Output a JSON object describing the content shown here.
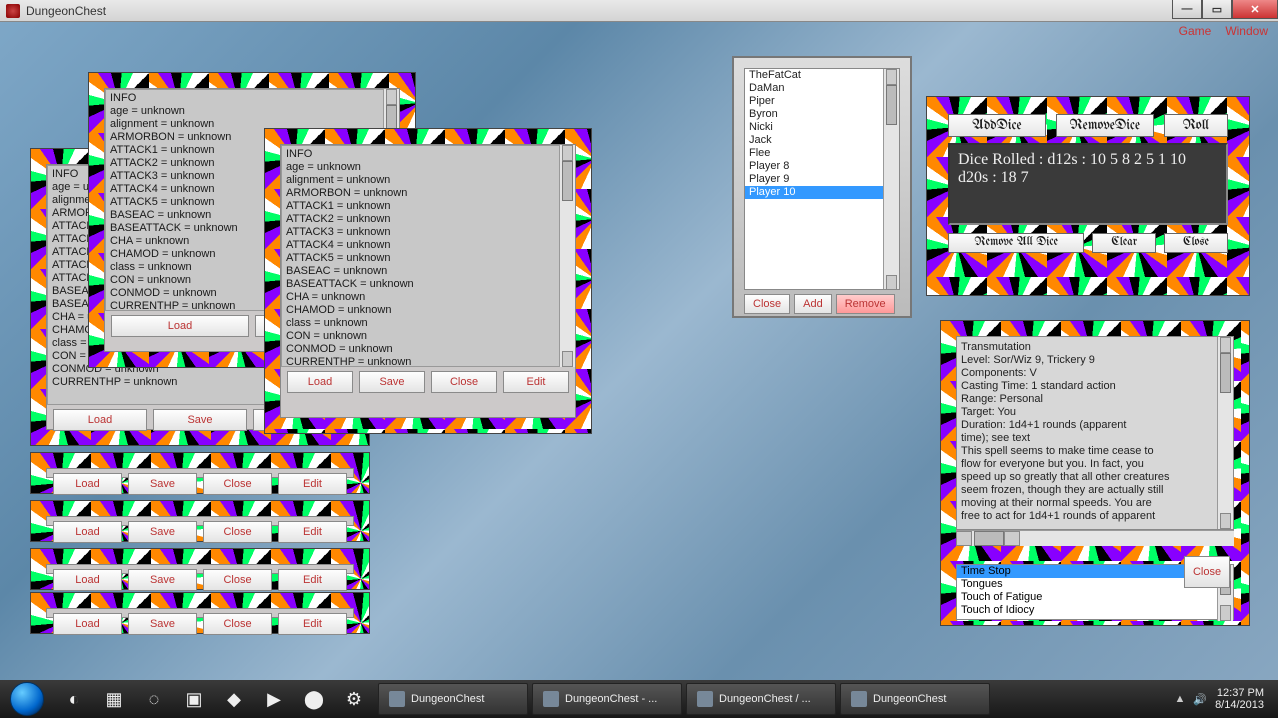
{
  "window": {
    "title": "DungeonChest",
    "menu": {
      "game": "Game",
      "window": "Window"
    }
  },
  "info_lines": "INFO\nage = unknown\nalignment = unknown\nARMORBON = unknown\nATTACK1 = unknown\nATTACK2 = unknown\nATTACK3 = unknown\nATTACK4 = unknown\nATTACK5 = unknown\nBASEAC = unknown\nBASEATTACK = unknown\nCHA = unknown\nCHAMOD = unknown\nclass = unknown\nCON = unknown\nCONMOD = unknown\nCURRENTHP = unknown",
  "btn": {
    "load": "Load",
    "save": "Save",
    "close": "Close",
    "edit": "Edit",
    "add": "Add",
    "remove": "Remove",
    "clear": "Clear"
  },
  "players": [
    "TheFatCat",
    "DaMan",
    "Piper",
    "Byron",
    "Nicki",
    "Jack",
    "Flee",
    "Player 8",
    "Player 9",
    "Player 10"
  ],
  "players_sel": 9,
  "dice": {
    "add": "AddDice",
    "remove": "RemoveDice",
    "roll": "Roll",
    "out": "Dice Rolled : d12s : 10 5 8 2 5 1 10 d20s : 18 7",
    "removeall": "Remove All Dice"
  },
  "spell": {
    "text": "Transmutation\nLevel: Sor/Wiz 9, Trickery 9\nComponents: V\nCasting Time: 1 standard action\nRange: Personal\nTarget: You\nDuration: 1d4+1 rounds (apparent\ntime); see text\nThis spell seems to make time cease to\nflow for everyone but you. In fact, you\nspeed up so greatly that all other creatures\nseem frozen, though they are actually still\nmoving at their normal speeds. You are\nfree to act for 1d4+1 rounds of apparent",
    "list": [
      "Time Stop",
      "Tongues",
      "Touch of Fatigue",
      "Touch of Idiocy"
    ],
    "sel": 0
  },
  "taskbar": {
    "items": [
      "DungeonChest",
      "DungeonChest - ...",
      "DungeonChest / ...",
      "DungeonChest"
    ],
    "time": "12:37 PM",
    "date": "8/14/2013"
  }
}
